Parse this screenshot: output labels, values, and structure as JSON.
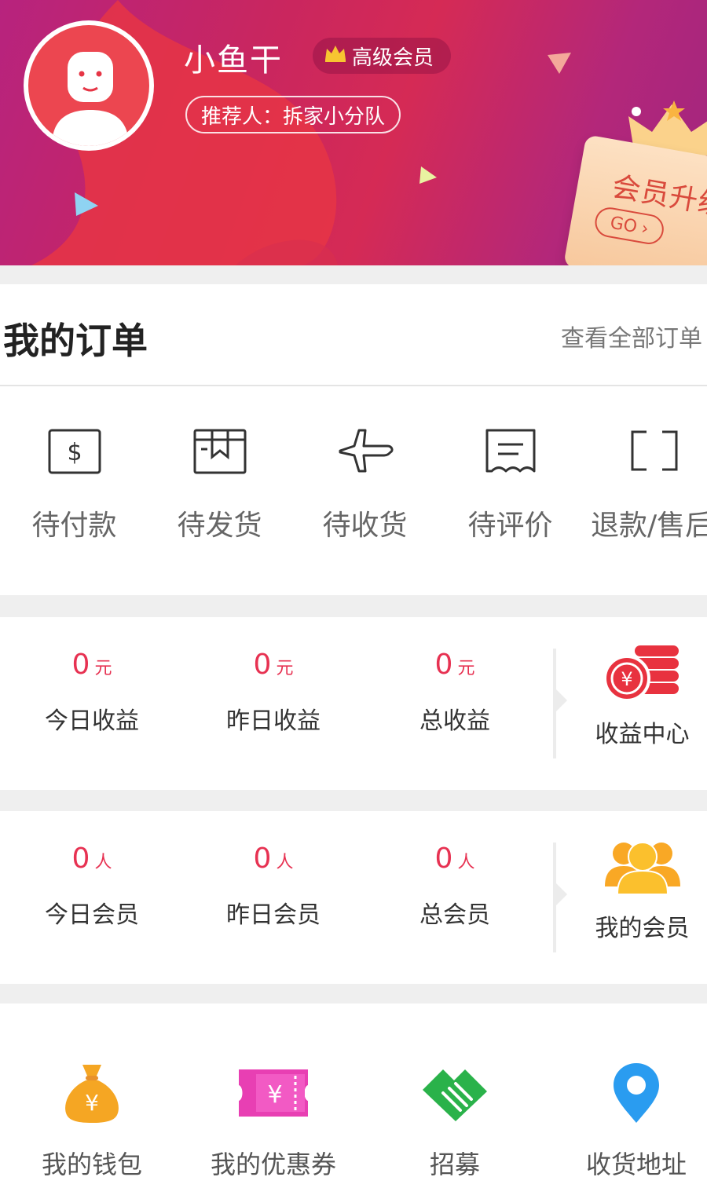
{
  "profile": {
    "nickname": "小鱼干",
    "level": "高级会员",
    "referrer": "推荐人：拆家小分队"
  },
  "upgrade": {
    "title": "会员升级",
    "go": "GO"
  },
  "orders": {
    "title": "我的订单",
    "view_all": "查看全部订单",
    "items": [
      {
        "label": "待付款",
        "icon": "dollar-card-icon"
      },
      {
        "label": "待发货",
        "icon": "box-icon"
      },
      {
        "label": "待收货",
        "icon": "airplane-icon"
      },
      {
        "label": "待评价",
        "icon": "receipt-icon"
      },
      {
        "label": "退款/售后",
        "icon": "bracket-frame-icon"
      }
    ]
  },
  "earnings": {
    "items": [
      {
        "value": "0",
        "unit": "元",
        "label": "今日收益"
      },
      {
        "value": "0",
        "unit": "元",
        "label": "昨日收益"
      },
      {
        "value": "0",
        "unit": "元",
        "label": "总收益"
      }
    ],
    "center_label": "收益中心"
  },
  "members": {
    "items": [
      {
        "value": "0",
        "unit": "人",
        "label": "今日会员"
      },
      {
        "value": "0",
        "unit": "人",
        "label": "昨日会员"
      },
      {
        "value": "0",
        "unit": "人",
        "label": "总会员"
      }
    ],
    "center_label": "我的会员"
  },
  "tools": {
    "items": [
      {
        "label": "我的钱包",
        "icon": "money-bag-icon"
      },
      {
        "label": "我的优惠券",
        "icon": "coupon-icon"
      },
      {
        "label": "招募",
        "icon": "handshake-icon"
      },
      {
        "label": "收货地址",
        "icon": "location-pin-icon"
      }
    ]
  },
  "colors": {
    "accent": "#e73252",
    "header_start": "#b7237e",
    "header_mid": "#d52a55",
    "gold": "#f5a623"
  }
}
